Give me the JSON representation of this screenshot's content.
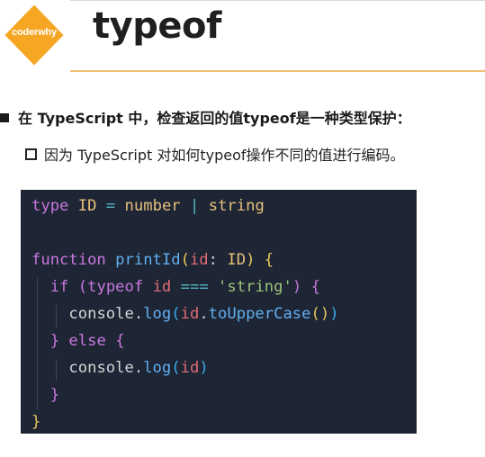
{
  "logo": {
    "text": "coderwhy",
    "color": "#f5a623"
  },
  "title": "typeof",
  "bullets": [
    "在 TypeScript 中，检查返回的值typeof是一种类型保护：",
    "因为 TypeScript 对如何typeof操作不同的值进行编码。"
  ],
  "code": {
    "line1": {
      "kw": "type",
      "name": "ID",
      "eq": "=",
      "t1": "number",
      "bar": "|",
      "t2": "string"
    },
    "line3": {
      "kw": "function",
      "name": "printId",
      "po": "(",
      "param": "id",
      "colon": ":",
      "type": "ID",
      "pc": ")",
      "brace": "{"
    },
    "line4": {
      "kw": "if",
      "po": "(",
      "typeof": "typeof",
      "id": "id",
      "eq": "===",
      "str": "'string'",
      "pc": ")",
      "brace": "{"
    },
    "line5": {
      "obj": "console",
      "dot1": ".",
      "fn": "log",
      "po": "(",
      "id": "id",
      "dot2": ".",
      "method": "toUpperCase",
      "call": "()",
      "pc": ")"
    },
    "line6": {
      "close": "}",
      "kw": "else",
      "brace": "{"
    },
    "line7": {
      "obj": "console",
      "dot": ".",
      "fn": "log",
      "po": "(",
      "id": "id",
      "pc": ")"
    },
    "line8": {
      "close": "}"
    },
    "line9": {
      "close": "}"
    }
  },
  "colors": {
    "code_bg": "#1e2535",
    "accent_line": "#f0c070"
  }
}
